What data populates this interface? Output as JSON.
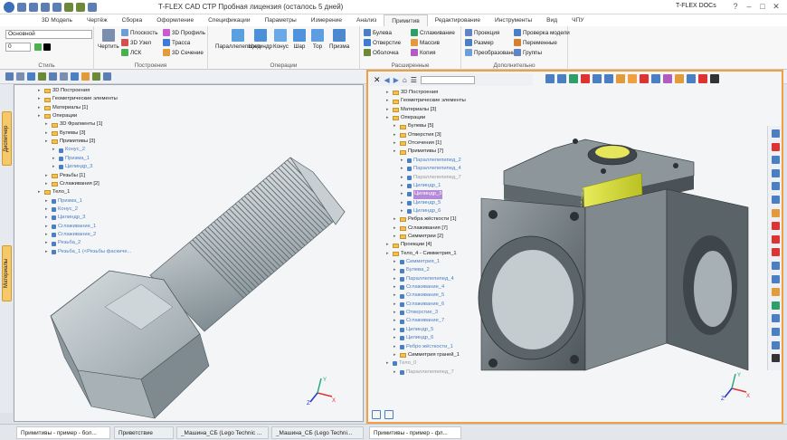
{
  "app": {
    "title": "T-FLEX CAD СТР Пробная лицензия (осталось 5 дней)",
    "docs_button": "T-FLEX DOCs"
  },
  "tabs": [
    "3D Модель",
    "Чертёж",
    "Сборка",
    "Оформление",
    "Спецификации",
    "Параметры",
    "Измерение",
    "Анализ",
    "Примитив",
    "Редактирование",
    "Инструменты",
    "Вид",
    "ЧПУ"
  ],
  "active_tab": "Примитив",
  "ribbon": {
    "style": {
      "label": "Стиль",
      "layer": "Основной",
      "width": "0"
    },
    "build": {
      "label": "Построения",
      "draw": "Чертить",
      "plane": "Плоскость",
      "node": "3D Узел",
      "lsk": "ЛСК",
      "profile": "3D Профиль",
      "trace": "Трасса",
      "section": "3D Сечение"
    },
    "ops": {
      "label": "Операции",
      "items": [
        "Параллелепипед",
        "Цилиндр",
        "Конус",
        "Шар",
        "Тор",
        "Призма"
      ]
    },
    "ext": {
      "label": "Расширенные",
      "items": [
        "Булева",
        "Отверстие",
        "Оболочка",
        "Сглаживание",
        "Массив",
        "Копия"
      ]
    },
    "add": {
      "label": "Дополнительно",
      "items": [
        "Проекция",
        "Размер",
        "Преобразование",
        "Проверка модели",
        "Переменные",
        "Группы"
      ]
    }
  },
  "side_tabs": [
    "Диспетчер",
    "Материалы"
  ],
  "left_tree": [
    {
      "t": "3D Построения",
      "c": "n",
      "i": 0
    },
    {
      "t": "Геометрические элементы",
      "c": "n",
      "i": 0
    },
    {
      "t": "Материалы [1]",
      "c": "n",
      "i": 0
    },
    {
      "t": "Операции",
      "c": "n",
      "i": 0
    },
    {
      "t": "3D Фрагменты [1]",
      "c": "n",
      "i": 1
    },
    {
      "t": "Булевы [3]",
      "c": "n",
      "i": 1
    },
    {
      "t": "Примитивы [3]",
      "c": "n",
      "i": 1
    },
    {
      "t": "Конус_2",
      "c": "b",
      "i": 2
    },
    {
      "t": "Призма_1",
      "c": "b",
      "i": 2
    },
    {
      "t": "Цилиндр_3",
      "c": "b",
      "i": 2
    },
    {
      "t": "Резьбы [1]",
      "c": "n",
      "i": 1
    },
    {
      "t": "Сглаживания [2]",
      "c": "n",
      "i": 1
    },
    {
      "t": "Тело_1",
      "c": "n",
      "i": 0
    },
    {
      "t": "Призма_1",
      "c": "b",
      "i": 1
    },
    {
      "t": "Конус_2",
      "c": "b",
      "i": 1
    },
    {
      "t": "Цилиндр_3",
      "c": "b",
      "i": 1
    },
    {
      "t": "Сглаживание_1",
      "c": "b",
      "i": 1
    },
    {
      "t": "Сглаживание_2",
      "c": "b",
      "i": 1
    },
    {
      "t": "Резьба_2",
      "c": "b",
      "i": 1
    },
    {
      "t": "Резьба_1 (<Резьбы фаскиче...",
      "c": "b",
      "i": 1
    }
  ],
  "right_tree": [
    {
      "t": "3D Построения",
      "c": "n",
      "i": 0
    },
    {
      "t": "Геометрические элементы",
      "c": "n",
      "i": 0
    },
    {
      "t": "Материалы [3]",
      "c": "n",
      "i": 0
    },
    {
      "t": "Операции",
      "c": "n",
      "i": 0
    },
    {
      "t": "Булевы [5]",
      "c": "n",
      "i": 1
    },
    {
      "t": "Отверстия [3]",
      "c": "n",
      "i": 1
    },
    {
      "t": "Отсечения [1]",
      "c": "n",
      "i": 1
    },
    {
      "t": "Примитивы [7]",
      "c": "n",
      "i": 1
    },
    {
      "t": "Параллелепипед_2",
      "c": "b",
      "i": 2
    },
    {
      "t": "Параллелепипед_4",
      "c": "b",
      "i": 2
    },
    {
      "t": "Параллелепипед_7",
      "c": "g",
      "i": 2
    },
    {
      "t": "Цилиндр_1",
      "c": "b",
      "i": 2
    },
    {
      "t": "Цилиндр_3",
      "c": "h",
      "i": 2
    },
    {
      "t": "Цилиндр_5",
      "c": "b",
      "i": 2
    },
    {
      "t": "Цилиндр_6",
      "c": "b",
      "i": 2
    },
    {
      "t": "Ребра жёсткости [1]",
      "c": "n",
      "i": 1
    },
    {
      "t": "Сглаживания [7]",
      "c": "n",
      "i": 1
    },
    {
      "t": "Симметрии [2]",
      "c": "n",
      "i": 1
    },
    {
      "t": "Проекции [4]",
      "c": "n",
      "i": 0
    },
    {
      "t": "Тело_4 - Симметрия_1",
      "c": "n",
      "i": 0
    },
    {
      "t": "Симметрия_1",
      "c": "b",
      "i": 1
    },
    {
      "t": "Булева_2",
      "c": "b",
      "i": 1
    },
    {
      "t": "Параллелепипед_4",
      "c": "b",
      "i": 1
    },
    {
      "t": "Сглаживание_4",
      "c": "b",
      "i": 1
    },
    {
      "t": "Сглаживание_5",
      "c": "b",
      "i": 1
    },
    {
      "t": "Сглаживание_6",
      "c": "b",
      "i": 1
    },
    {
      "t": "Отверстие_3",
      "c": "b",
      "i": 1
    },
    {
      "t": "Сглаживание_7",
      "c": "b",
      "i": 1
    },
    {
      "t": "Цилиндр_5",
      "c": "b",
      "i": 1
    },
    {
      "t": "Цилиндр_6",
      "c": "b",
      "i": 1
    },
    {
      "t": "Ребро жёсткости_1",
      "c": "b",
      "i": 1
    },
    {
      "t": "Симметрия граней_1",
      "c": "n",
      "i": 1
    },
    {
      "t": "Тело_0",
      "c": "g",
      "i": 0
    },
    {
      "t": "Параллелепипед_7",
      "c": "g",
      "i": 1
    }
  ],
  "bottom_docs": [
    "Примитивы - пример - бол...",
    "Приветствие",
    "_Машина_СБ (Lego Technic ...",
    "_Машина_СБ (Lego Techni...",
    "Примитивы - пример - фл..."
  ],
  "axes": {
    "x": "X",
    "y": "Y",
    "z": "Z"
  }
}
